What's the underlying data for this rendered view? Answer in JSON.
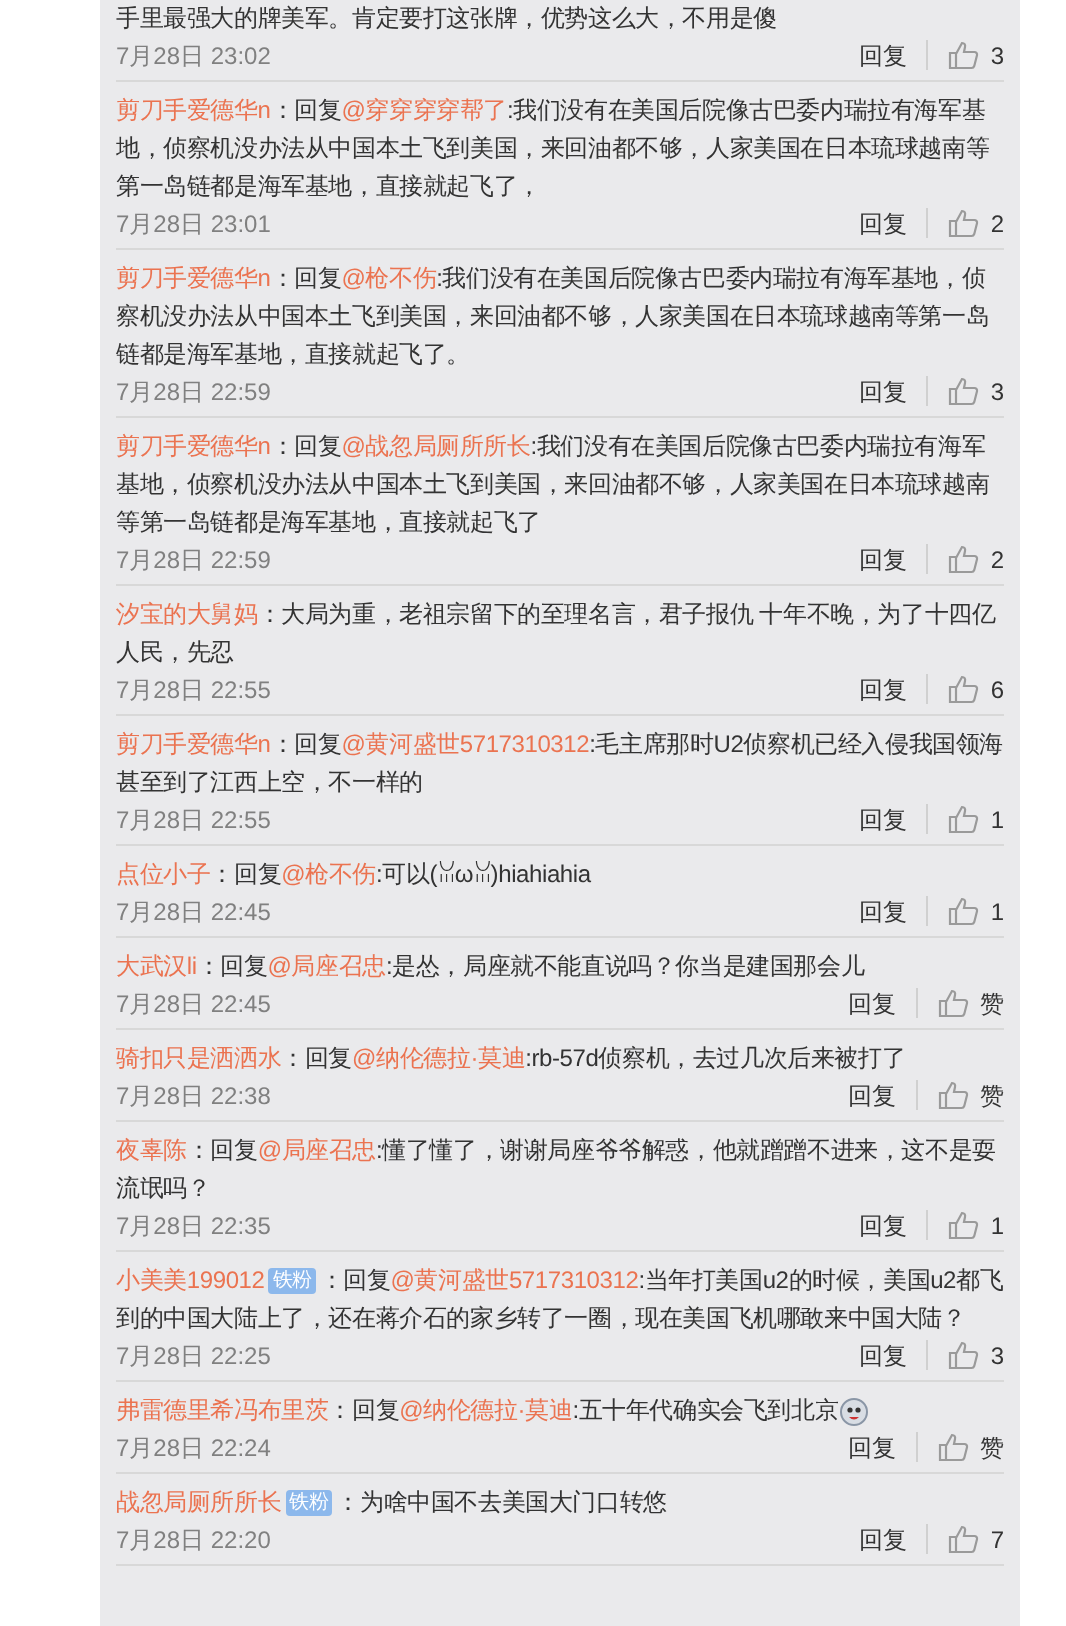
{
  "comments": [
    {
      "text": "手里最强大的牌美军。肯定要打这张牌，优势这么大，不用是傻",
      "time": "7月28日 23:02",
      "reply_label": "回复",
      "likes": "3"
    },
    {
      "user": "剪刀手爱德华n",
      "prefix": "：回复",
      "mention": "@穿穿穿穿帮了",
      "text": ":我们没有在美国后院像古巴委内瑞拉有海军基地，侦察机没办法从中国本土飞到美国，来回油都不够，人家美国在日本琉球越南等第一岛链都是海军基地，直接就起飞了，",
      "time": "7月28日 23:01",
      "reply_label": "回复",
      "likes": "2"
    },
    {
      "user": "剪刀手爱德华n",
      "prefix": "：回复",
      "mention": "@枪不伤",
      "text": ":我们没有在美国后院像古巴委内瑞拉有海军基地，侦察机没办法从中国本土飞到美国，来回油都不够，人家美国在日本琉球越南等第一岛链都是海军基地，直接就起飞了。",
      "time": "7月28日 22:59",
      "reply_label": "回复",
      "likes": "3"
    },
    {
      "user": "剪刀手爱德华n",
      "prefix": "：回复",
      "mention": "@战忽局厕所所长",
      "text": ":我们没有在美国后院像古巴委内瑞拉有海军基地，侦察机没办法从中国本土飞到美国，来回油都不够，人家美国在日本琉球越南等第一岛链都是海军基地，直接就起飞了",
      "time": "7月28日 22:59",
      "reply_label": "回复",
      "likes": "2"
    },
    {
      "user": "汐宝的大舅妈",
      "text": "：大局为重，老祖宗留下的至理名言，君子报仇 十年不晚，为了十四亿人民，先忍",
      "time": "7月28日 22:55",
      "reply_label": "回复",
      "likes": "6"
    },
    {
      "user": "剪刀手爱德华n",
      "prefix": "：回复",
      "mention": "@黄河盛世5717310312",
      "text": ":毛主席那时U2侦察机已经入侵我国领海甚至到了江西上空，不一样的",
      "time": "7月28日 22:55",
      "reply_label": "回复",
      "likes": "1"
    },
    {
      "user": "点位小子",
      "prefix": "：回复",
      "mention": "@枪不伤",
      "text": ":可以(ꈍωꈍ)hiahiahia",
      "time": "7月28日 22:45",
      "reply_label": "回复",
      "likes": "1"
    },
    {
      "user": "大武汉li",
      "prefix": "：回复",
      "mention": "@局座召忠",
      "text": ":是怂，局座就不能直说吗？你当是建国那会儿",
      "time": "7月28日 22:45",
      "reply_label": "回复",
      "likes": "赞"
    },
    {
      "user": "骑扣只是洒洒水",
      "prefix": "：回复",
      "mention": "@纳伦德拉·莫迪",
      "text": ":rb-57d侦察机，去过几次后来被打了",
      "time": "7月28日 22:38",
      "reply_label": "回复",
      "likes": "赞"
    },
    {
      "user": "夜辜陈",
      "prefix": "：回复",
      "mention": "@局座召忠",
      "text": ":懂了懂了，谢谢局座爷爷解惑，他就蹭蹭不进来，这不是耍流氓吗？",
      "time": "7月28日 22:35",
      "reply_label": "回复",
      "likes": "1"
    },
    {
      "user": "小美美199012",
      "badge": "铁粉",
      "prefix": "：回复",
      "mention": "@黄河盛世5717310312",
      "text": ":当年打美国u2的时候，美国u2都飞到的中国大陆上了，还在蒋介石的家乡转了一圈，现在美国飞机哪敢来中国大陆？",
      "time": "7月28日 22:25",
      "reply_label": "回复",
      "likes": "3"
    },
    {
      "user": "弗雷德里希冯布里茨",
      "prefix": "：回复",
      "mention": "@纳伦德拉·莫迪",
      "text": ":五十年代确实会飞到北京",
      "emoji": true,
      "time": "7月28日 22:24",
      "reply_label": "回复",
      "likes": "赞"
    },
    {
      "user": "战忽局厕所所长",
      "badge": "铁粉",
      "text": "：为啥中国不去美国大门口转悠",
      "time": "7月28日 22:20",
      "reply_label": "回复",
      "likes": "7"
    }
  ]
}
